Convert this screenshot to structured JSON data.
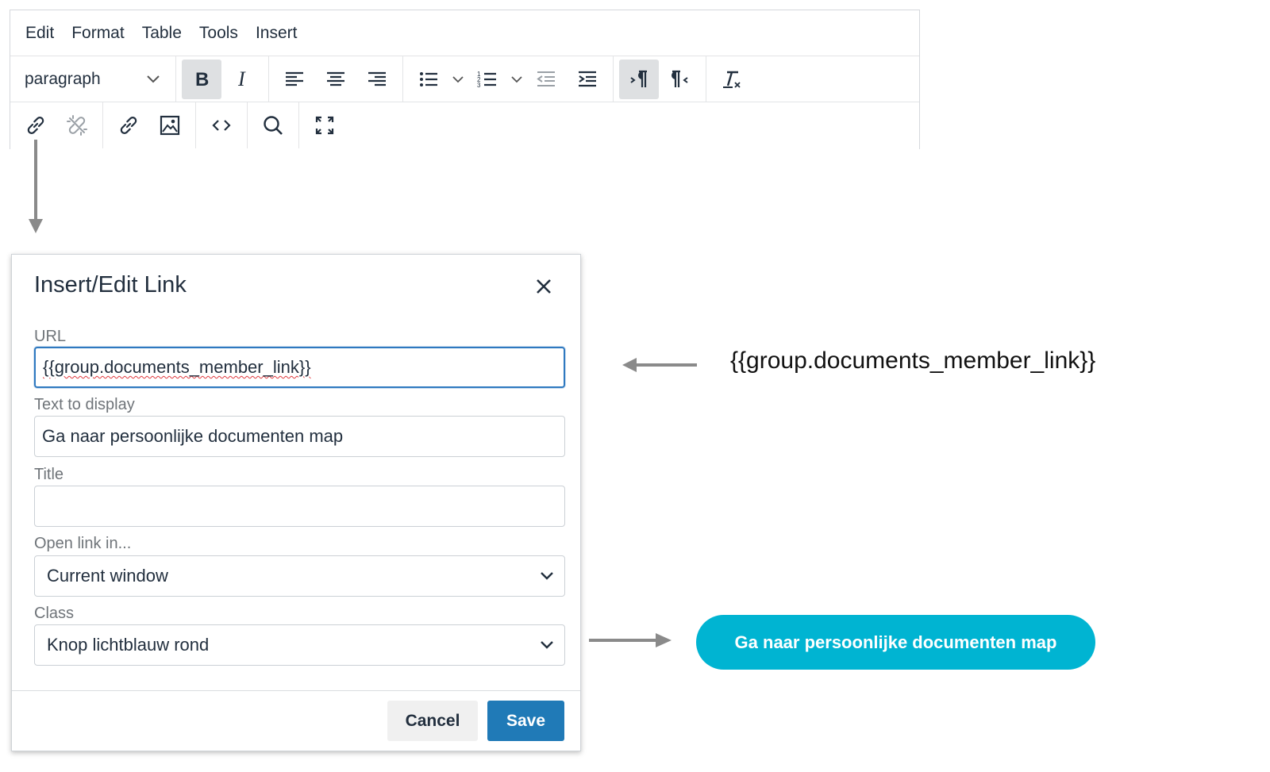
{
  "menubar": {
    "items": [
      "Edit",
      "Format",
      "Table",
      "Tools",
      "Insert"
    ]
  },
  "toolbar": {
    "block_format": "paragraph",
    "icons_row1": [
      "bold-icon",
      "italic-icon",
      "align-left-icon",
      "align-center-icon",
      "align-right-icon",
      "bullet-list-icon",
      "numbered-list-icon",
      "outdent-icon",
      "indent-icon",
      "ltr-icon",
      "rtl-icon",
      "clear-formatting-icon"
    ],
    "icons_row2": [
      "link-icon",
      "unlink-icon",
      "link-icon",
      "image-icon",
      "source-code-icon",
      "search-icon",
      "fullscreen-icon"
    ]
  },
  "dialog": {
    "title": "Insert/Edit Link",
    "url_label": "URL",
    "url_value": "{{group.documents_member_link}}",
    "text_label": "Text to display",
    "text_value": "Ga naar persoonlijke documenten map",
    "title_label": "Title",
    "title_value": "",
    "open_label": "Open link in...",
    "open_value": "Current window",
    "class_label": "Class",
    "class_value": "Knop lichtblauw rond",
    "cancel_label": "Cancel",
    "save_label": "Save"
  },
  "annotations": {
    "url_text": "{{group.documents_member_link}}",
    "button_text": "Ga naar persoonlijke documenten map"
  },
  "colors": {
    "accent": "#207ab7",
    "preview_button": "#00b4d2",
    "active_tool": "#dee0e2",
    "arrow": "#8a8a8a"
  }
}
